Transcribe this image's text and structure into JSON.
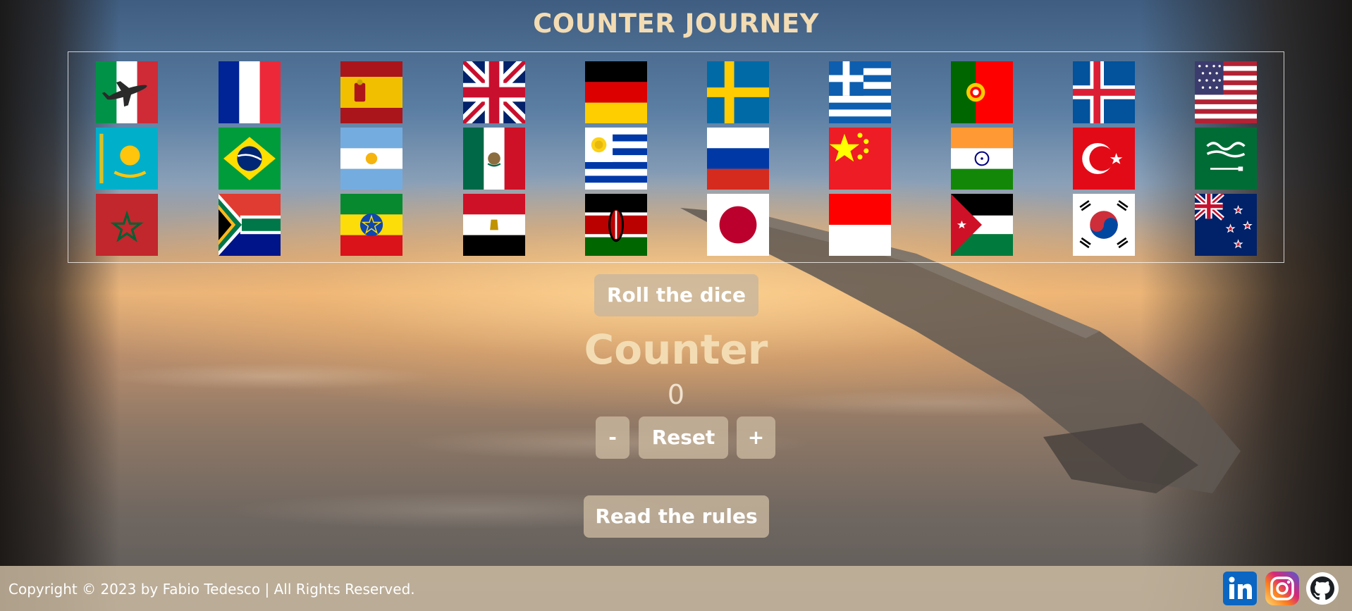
{
  "header": {
    "title": "COUNTER JOURNEY"
  },
  "flags": [
    {
      "name": "italy-flag-icon",
      "country": "italy"
    },
    {
      "name": "france-flag-icon",
      "country": "france"
    },
    {
      "name": "spain-flag-icon",
      "country": "spain"
    },
    {
      "name": "uk-flag-icon",
      "country": "uk"
    },
    {
      "name": "germany-flag-icon",
      "country": "germany"
    },
    {
      "name": "sweden-flag-icon",
      "country": "sweden"
    },
    {
      "name": "greece-flag-icon",
      "country": "greece"
    },
    {
      "name": "portugal-flag-icon",
      "country": "portugal"
    },
    {
      "name": "iceland-flag-icon",
      "country": "iceland"
    },
    {
      "name": "usa-flag-icon",
      "country": "usa"
    },
    {
      "name": "kazakhstan-flag-icon",
      "country": "kazakhstan"
    },
    {
      "name": "brazil-flag-icon",
      "country": "brazil"
    },
    {
      "name": "argentina-flag-icon",
      "country": "argentina"
    },
    {
      "name": "mexico-flag-icon",
      "country": "mexico"
    },
    {
      "name": "uruguay-flag-icon",
      "country": "uruguay"
    },
    {
      "name": "russia-flag-icon",
      "country": "russia"
    },
    {
      "name": "china-flag-icon",
      "country": "china"
    },
    {
      "name": "india-flag-icon",
      "country": "india"
    },
    {
      "name": "turkey-flag-icon",
      "country": "turkey"
    },
    {
      "name": "saudi-arabia-flag-icon",
      "country": "saudi"
    },
    {
      "name": "morocco-flag-icon",
      "country": "morocco"
    },
    {
      "name": "south-africa-flag-icon",
      "country": "southafrica"
    },
    {
      "name": "ethiopia-flag-icon",
      "country": "ethiopia"
    },
    {
      "name": "egypt-flag-icon",
      "country": "egypt"
    },
    {
      "name": "kenya-flag-icon",
      "country": "kenya"
    },
    {
      "name": "japan-flag-icon",
      "country": "japan"
    },
    {
      "name": "indonesia-flag-icon",
      "country": "indonesia"
    },
    {
      "name": "jordan-flag-icon",
      "country": "jordan"
    },
    {
      "name": "south-korea-flag-icon",
      "country": "korea"
    },
    {
      "name": "new-zealand-flag-icon",
      "country": "newzealand"
    }
  ],
  "player_marker": {
    "icon": "airplane-icon",
    "on_flag": "italy"
  },
  "controls": {
    "roll_label": "Roll the dice",
    "counter_label": "Counter",
    "counter_value": "0",
    "minus_label": "-",
    "reset_label": "Reset",
    "plus_label": "+",
    "rules_label": "Read the rules"
  },
  "footer": {
    "copyright": "Copyright © 2023 by Fabio Tedesco | All Rights Reserved.",
    "social": [
      {
        "icon": "linkedin-icon",
        "color": "#0a66c2"
      },
      {
        "icon": "instagram-icon",
        "color": "#d62976"
      },
      {
        "icon": "github-icon",
        "color": "#ffffff"
      }
    ]
  }
}
